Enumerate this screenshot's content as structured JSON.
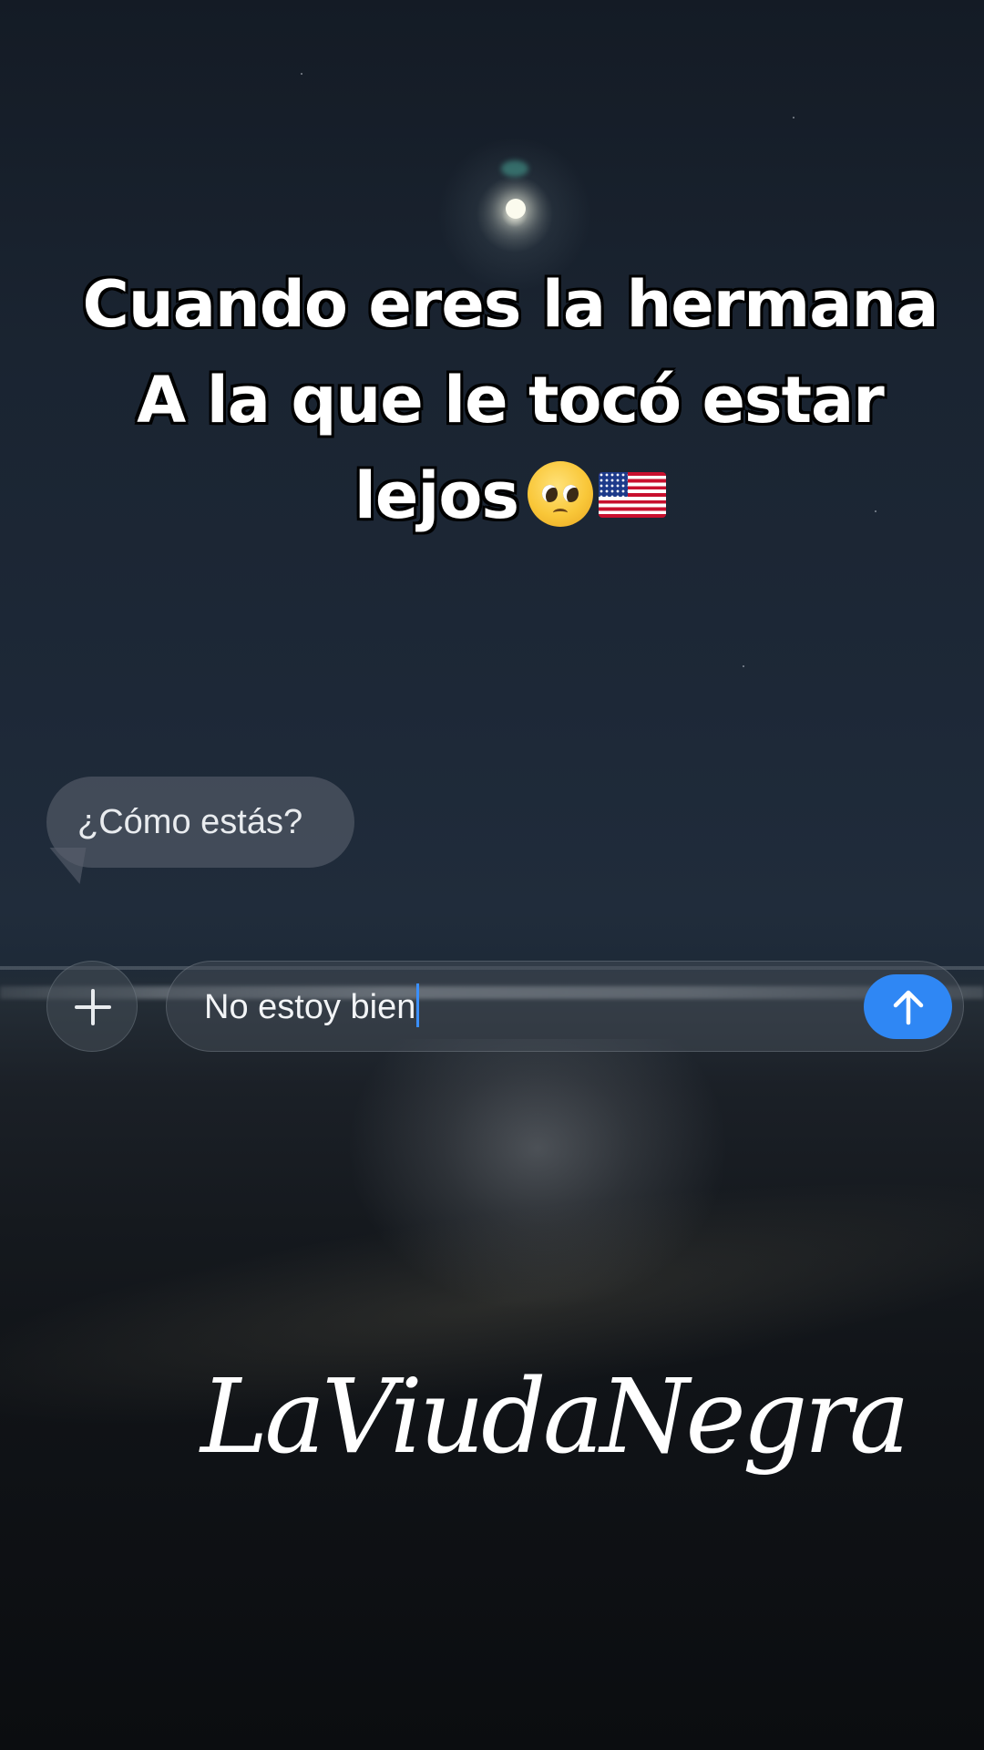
{
  "caption": {
    "line1": "Cuando eres la hermana",
    "line2": "A la que le tocó estar",
    "line3": "lejos",
    "emojis": [
      "pleading-face",
      "us-flag"
    ]
  },
  "chat": {
    "incoming_message": "¿Cómo estás?",
    "composer_text": "No estoy bien",
    "plus_icon": "plus-icon",
    "send_icon": "arrow-up-icon",
    "send_color": "#2f87f4"
  },
  "watermark": {
    "text": "LaViudaNegra"
  }
}
